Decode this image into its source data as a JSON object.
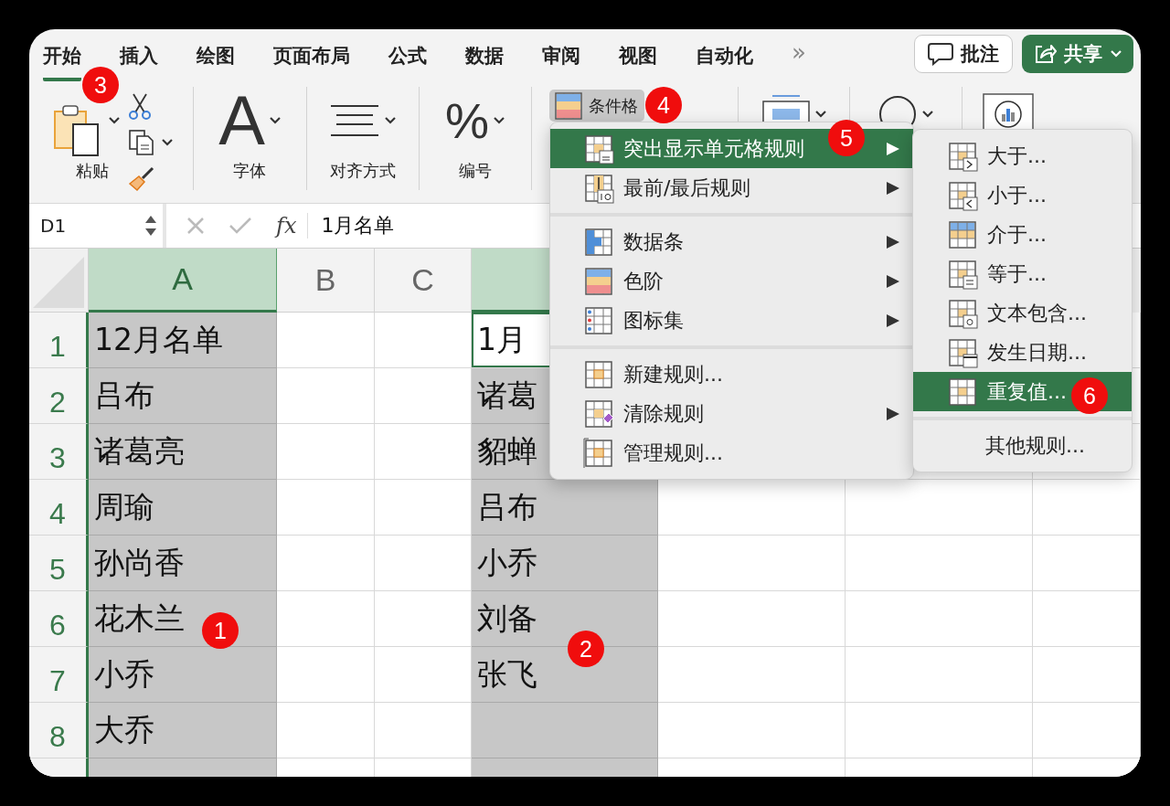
{
  "tabs": [
    {
      "label": "开始",
      "selected": true
    },
    {
      "label": "插入",
      "selected": false
    },
    {
      "label": "绘图",
      "selected": false
    },
    {
      "label": "页面布局",
      "selected": false
    },
    {
      "label": "公式",
      "selected": false
    },
    {
      "label": "数据",
      "selected": false
    },
    {
      "label": "审阅",
      "selected": false
    },
    {
      "label": "视图",
      "selected": false
    },
    {
      "label": "自动化",
      "selected": false
    }
  ],
  "overflow_glyph": "»",
  "comment_button": {
    "label": "批注"
  },
  "share_button": {
    "label": "共享"
  },
  "ribbon": {
    "paste": "粘贴",
    "font_glyph": "A",
    "font": "字体",
    "alignment": "对齐方式",
    "number_glyph": "%",
    "number": "编号",
    "conditional_formatting": "条件格"
  },
  "formula_bar": {
    "name_box": "D1",
    "fx": "fx",
    "formula": "1月名单"
  },
  "columns": [
    {
      "label": "A",
      "selected": true
    },
    {
      "label": "B",
      "selected": false
    },
    {
      "label": "C",
      "selected": false
    },
    {
      "selected": true
    }
  ],
  "rows": [
    {
      "number": "1",
      "a": {
        "text": "12月名单",
        "selected": true
      },
      "d": {
        "text": "1月",
        "selected": false,
        "active": true
      }
    },
    {
      "number": "2",
      "a": {
        "text": "吕布",
        "selected": true
      },
      "d": {
        "text": "诸葛",
        "selected": true,
        "active": false
      }
    },
    {
      "number": "3",
      "a": {
        "text": "诸葛亮",
        "selected": true
      },
      "d": {
        "text": "貂蝉",
        "selected": true,
        "active": false
      }
    },
    {
      "number": "4",
      "a": {
        "text": "周瑜",
        "selected": true
      },
      "d": {
        "text": "吕布",
        "selected": true,
        "active": false
      }
    },
    {
      "number": "5",
      "a": {
        "text": "孙尚香",
        "selected": true
      },
      "d": {
        "text": "小乔",
        "selected": true,
        "active": false
      }
    },
    {
      "number": "6",
      "a": {
        "text": "花木兰",
        "selected": true
      },
      "d": {
        "text": "刘备",
        "selected": true,
        "active": false
      }
    },
    {
      "number": "7",
      "a": {
        "text": "小乔",
        "selected": true
      },
      "d": {
        "text": "张飞",
        "selected": true,
        "active": false
      }
    },
    {
      "number": "8",
      "a": {
        "text": "大乔",
        "selected": true
      },
      "d": {
        "selected": true,
        "active": false
      }
    },
    {
      "a": {
        "selected": true
      },
      "d": {
        "selected": true,
        "active": false
      }
    }
  ],
  "menu": {
    "sections": [
      [
        {
          "label": "突出显示单元格规则",
          "selected": true,
          "submenu": true
        },
        {
          "label": "最前/最后规则",
          "selected": false,
          "submenu": true
        }
      ],
      [
        {
          "label": "数据条",
          "selected": false,
          "submenu": true
        },
        {
          "label": "色阶",
          "selected": false,
          "submenu": true
        },
        {
          "label": "图标集",
          "selected": false,
          "submenu": true
        }
      ],
      [
        {
          "label": "新建规则...",
          "selected": false,
          "submenu": false
        },
        {
          "label": "清除规则",
          "selected": false,
          "submenu": true
        },
        {
          "label": "管理规则...",
          "selected": false,
          "submenu": false
        }
      ]
    ]
  },
  "submenu": {
    "sections": [
      [
        {
          "label": "大于...",
          "selected": false
        },
        {
          "label": "小于...",
          "selected": false
        },
        {
          "label": "介于...",
          "selected": false
        },
        {
          "label": "等于...",
          "selected": false
        },
        {
          "label": "文本包含...",
          "selected": false
        },
        {
          "label": "发生日期...",
          "selected": false
        },
        {
          "label": "重复值...",
          "selected": true
        }
      ],
      [
        {
          "label": "其他规则...",
          "selected": false
        }
      ]
    ]
  },
  "badges": [
    "1",
    "2",
    "3",
    "4",
    "5",
    "6"
  ]
}
